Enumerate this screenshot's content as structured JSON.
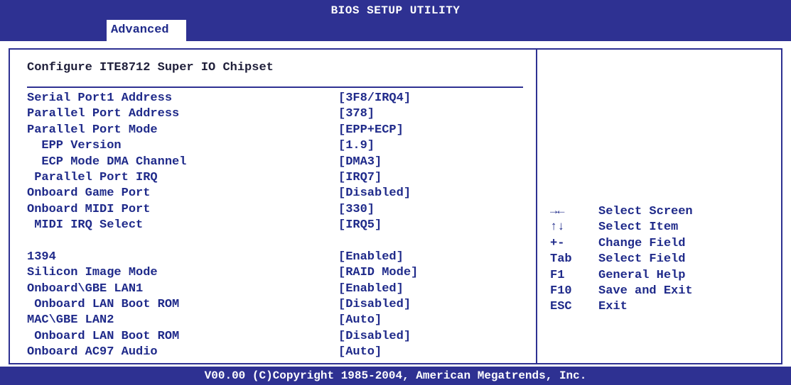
{
  "header": {
    "title": "BIOS SETUP UTILITY",
    "active_tab": "Advanced"
  },
  "panel": {
    "section_title": "Configure ITE8712 Super IO Chipset",
    "rows": [
      {
        "label": "Serial Port1 Address",
        "value": "[3F8/IRQ4]"
      },
      {
        "label": "Parallel Port Address",
        "value": "[378]"
      },
      {
        "label": "Parallel Port Mode",
        "value": "[EPP+ECP]"
      },
      {
        "label": "  EPP Version",
        "value": "[1.9]"
      },
      {
        "label": "  ECP Mode DMA Channel",
        "value": "[DMA3]"
      },
      {
        "label": " Parallel Port IRQ",
        "value": "[IRQ7]"
      },
      {
        "label": "Onboard Game Port",
        "value": "[Disabled]"
      },
      {
        "label": "Onboard MIDI Port",
        "value": "[330]"
      },
      {
        "label": " MIDI IRQ Select",
        "value": "[IRQ5]"
      },
      {
        "label": "",
        "value": ""
      },
      {
        "label": "1394",
        "value": "[Enabled]"
      },
      {
        "label": "Silicon Image Mode",
        "value": "[RAID Mode]"
      },
      {
        "label": "Onboard\\GBE LAN1",
        "value": "[Enabled]"
      },
      {
        "label": " Onboard LAN Boot ROM",
        "value": "[Disabled]"
      },
      {
        "label": "MAC\\GBE LAN2",
        "value": "[Auto]"
      },
      {
        "label": " Onboard LAN Boot ROM",
        "value": "[Disabled]"
      },
      {
        "label": "Onboard AC97 Audio",
        "value": "[Auto]"
      }
    ]
  },
  "help": [
    {
      "key": "→←",
      "desc": "Select Screen"
    },
    {
      "key": "↑↓",
      "desc": "Select Item"
    },
    {
      "key": "+-",
      "desc": "Change Field"
    },
    {
      "key": "Tab",
      "desc": "Select Field"
    },
    {
      "key": "F1",
      "desc": "General Help"
    },
    {
      "key": "F10",
      "desc": "Save and Exit"
    },
    {
      "key": "ESC",
      "desc": "Exit"
    }
  ],
  "footer": {
    "copyright": "V00.00 (C)Copyright 1985-2004, American Megatrends, Inc."
  },
  "colors": {
    "bar": "#2e3192",
    "text": "#1f2a8a",
    "background": "#ffffff"
  }
}
